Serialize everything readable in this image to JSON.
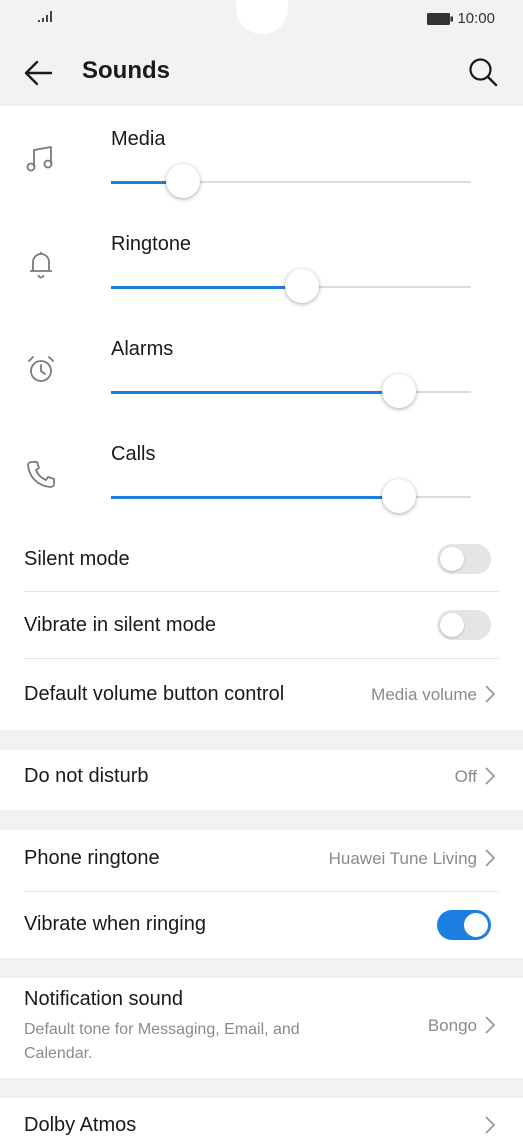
{
  "status_bar": {
    "time": "10:00"
  },
  "header": {
    "title": "Sounds"
  },
  "volumes": [
    {
      "label": "Media",
      "icon": "music-note-icon",
      "level": 0.2
    },
    {
      "label": "Ringtone",
      "icon": "bell-icon",
      "level": 0.53
    },
    {
      "label": "Alarms",
      "icon": "alarm-clock-icon",
      "level": 0.8
    },
    {
      "label": "Calls",
      "icon": "phone-icon",
      "level": 0.8
    }
  ],
  "settings": {
    "silent_mode": {
      "label": "Silent mode",
      "enabled": false
    },
    "vibrate_silent": {
      "label": "Vibrate in silent mode",
      "enabled": false
    },
    "volume_button": {
      "label": "Default volume button control",
      "value": "Media volume"
    },
    "dnd": {
      "label": "Do not disturb",
      "value": "Off"
    },
    "phone_ringtone": {
      "label": "Phone ringtone",
      "value": "Huawei Tune Living"
    },
    "vibrate_ringing": {
      "label": "Vibrate when ringing",
      "enabled": true
    },
    "notification_sound": {
      "label": "Notification sound",
      "subtext": "Default tone for Messaging, Email, and Calendar.",
      "value": "Bongo"
    },
    "dolby": {
      "label": "Dolby Atmos"
    }
  },
  "colors": {
    "accent": "#1a7fe0",
    "background_gray": "#f2f2f2"
  }
}
